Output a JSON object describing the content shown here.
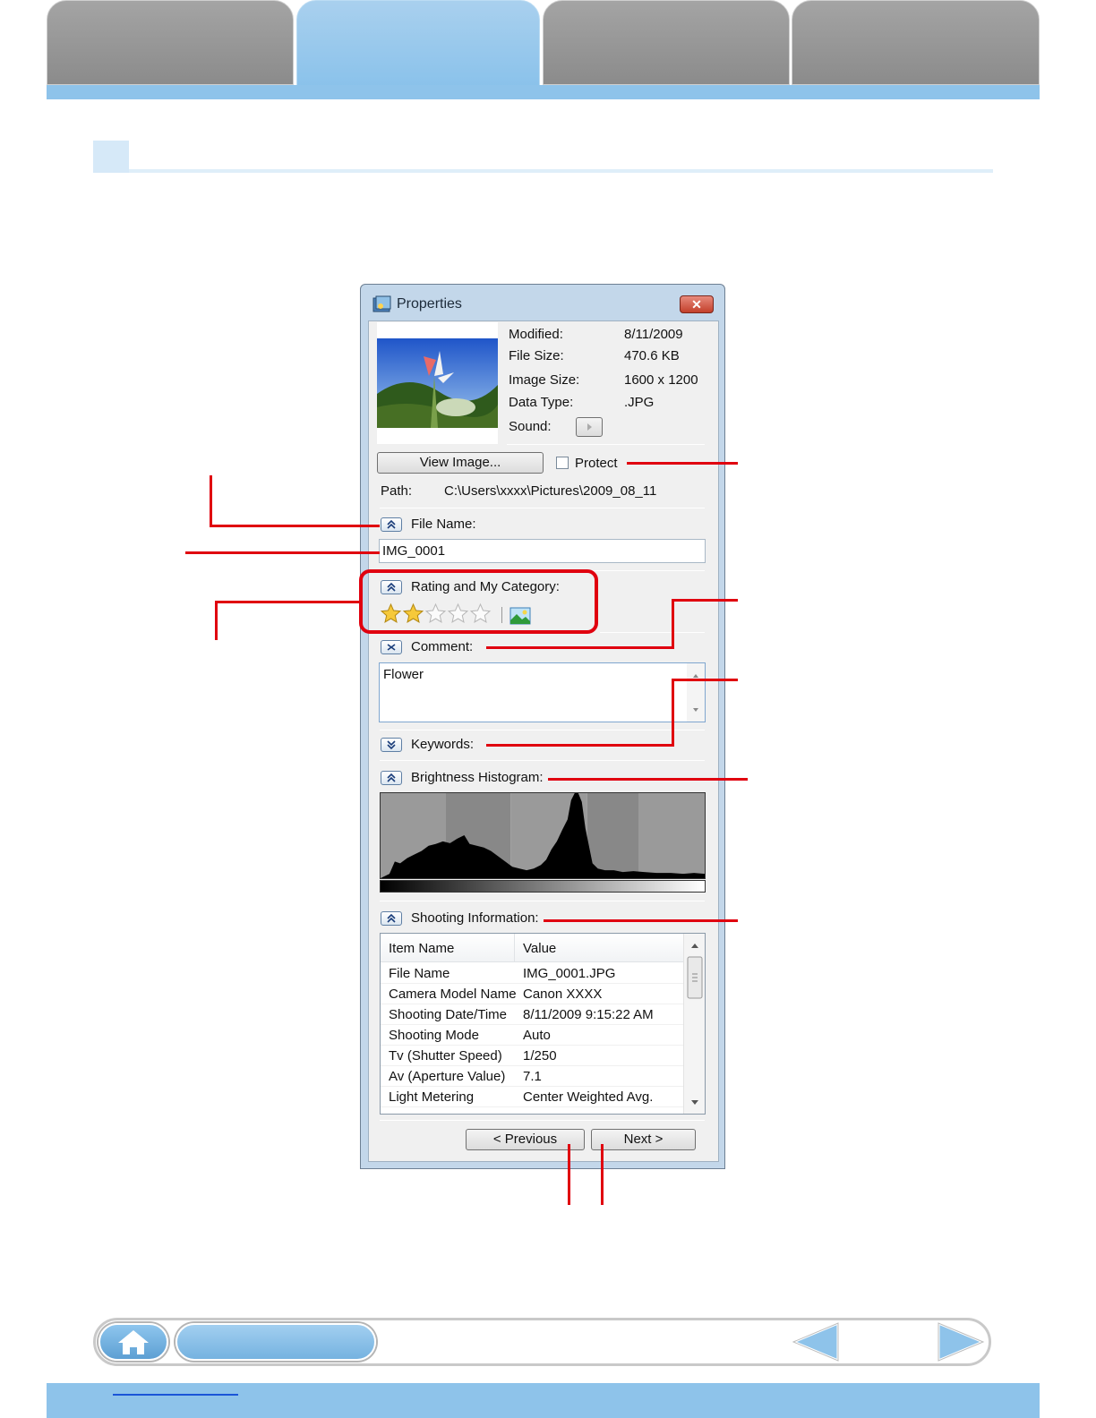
{
  "dialog": {
    "title": "Properties",
    "close_label": "✕",
    "info": [
      {
        "label": "Modified:",
        "value": "8/11/2009"
      },
      {
        "label": "File Size:",
        "value": "470.6 KB"
      },
      {
        "label": "Image Size:",
        "value": "1600 x 1200"
      },
      {
        "label": "Data Type:",
        "value": ".JPG"
      },
      {
        "label": "Sound:",
        "value": ""
      }
    ],
    "view_image_label": "View Image...",
    "protect_label": "Protect",
    "protect_checked": false,
    "path_label": "Path:",
    "path_value": "C:\\Users\\xxxx\\Pictures\\2009_08_11",
    "file_name_label": "File Name:",
    "file_name_value": "IMG_0001",
    "rating_label": "Rating and My Category:",
    "rating_stars": 2,
    "rating_max": 5,
    "comment_label": "Comment:",
    "comment_value": "Flower",
    "keywords_label": "Keywords:",
    "histogram_label": "Brightness Histogram:",
    "shooting_label": "Shooting Information:",
    "table": {
      "headers": [
        "Item Name",
        "Value"
      ],
      "rows": [
        [
          "File Name",
          "IMG_0001.JPG"
        ],
        [
          "Camera Model Name",
          "Canon XXXX"
        ],
        [
          "Shooting Date/Time",
          "8/11/2009 9:15:22 AM"
        ],
        [
          "Shooting Mode",
          "Auto"
        ],
        [
          "Tv (Shutter Speed)",
          "1/250"
        ],
        [
          "Av (Aperture Value)",
          "7.1"
        ],
        [
          "Light Metering",
          "Center Weighted Avg."
        ]
      ]
    },
    "previous_label": "< Previous",
    "next_label": "Next >"
  },
  "colors": {
    "annotation": "#e0000f",
    "tab_active": "#8ec3ea",
    "tab_inactive": "#999999"
  }
}
